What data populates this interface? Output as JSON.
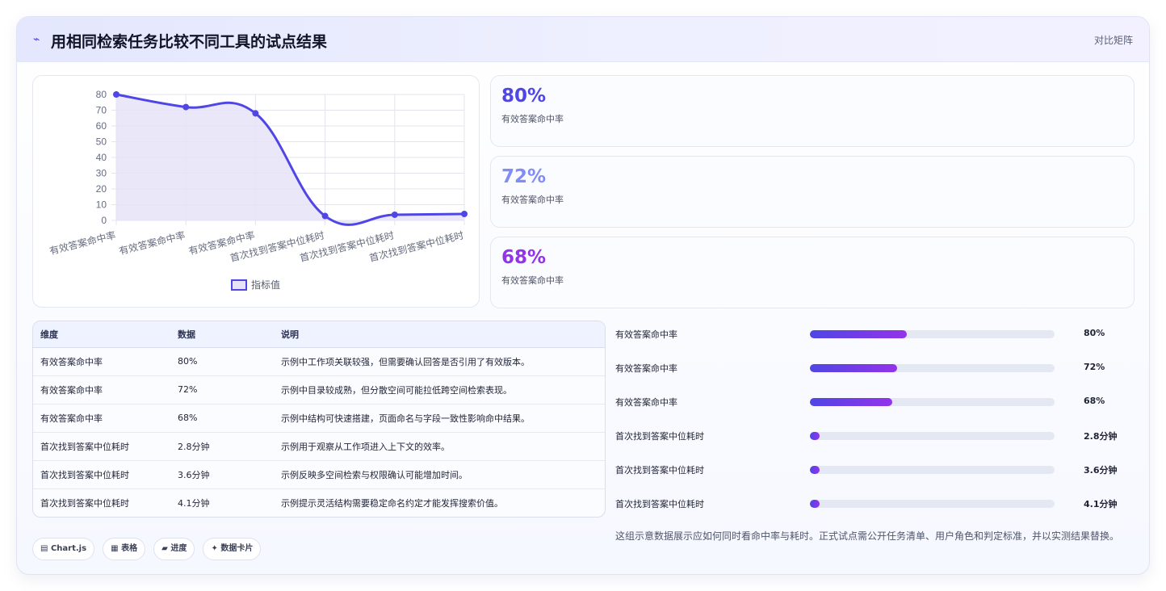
{
  "header": {
    "title_icon": "⌁",
    "title": "用相同检索任务比较不同工具的试点结果",
    "matrix_link": "对比矩阵"
  },
  "chart_data": {
    "type": "line",
    "categories": [
      "有效答案命中率",
      "有效答案命中率",
      "有效答案命中率",
      "首次找到答案中位耗时",
      "首次找到答案中位耗时",
      "首次找到答案中位耗时"
    ],
    "series": [
      {
        "name": "指标值",
        "values": [
          80,
          72,
          68,
          2.8,
          3.6,
          4.1
        ]
      }
    ],
    "ylim": [
      0,
      80
    ],
    "yticks": [
      0,
      10,
      20,
      30,
      40,
      50,
      60,
      70,
      80
    ],
    "grid": true,
    "fill": true,
    "legend_position": "bottom",
    "colors": {
      "line": "#4f46e5",
      "fill": "#e6e3f8"
    }
  },
  "kpis": [
    {
      "value": "80%",
      "label": "有效答案命中率",
      "color": "#4f46e5"
    },
    {
      "value": "72%",
      "label": "有效答案命中率",
      "color": "#818cf8"
    },
    {
      "value": "68%",
      "label": "有效答案命中率",
      "color": "#9333ea"
    }
  ],
  "table": {
    "headers": [
      "维度",
      "数据",
      "说明"
    ],
    "rows": [
      [
        "有效答案命中率",
        "80%",
        "示例中工作项关联较强，但需要确认回答是否引用了有效版本。"
      ],
      [
        "有效答案命中率",
        "72%",
        "示例中目录较成熟，但分散空间可能拉低跨空间检索表现。"
      ],
      [
        "有效答案命中率",
        "68%",
        "示例中结构可快速搭建，页面命名与字段一致性影响命中结果。"
      ],
      [
        "首次找到答案中位耗时",
        "2.8分钟",
        "示例用于观察从工作项进入上下文的效率。"
      ],
      [
        "首次找到答案中位耗时",
        "3.6分钟",
        "示例反映多空间检索与权限确认可能增加时间。"
      ],
      [
        "首次找到答案中位耗时",
        "4.1分钟",
        "示例提示灵活结构需要稳定命名约定才能发挥搜索价值。"
      ]
    ]
  },
  "chips": [
    {
      "icon": "▤",
      "label": "Chart.js"
    },
    {
      "icon": "▦",
      "label": "表格"
    },
    {
      "icon": "▰",
      "label": "进度"
    },
    {
      "icon": "✦",
      "label": "数据卡片"
    }
  ],
  "bars": [
    {
      "label": "有效答案命中率",
      "value": "80%",
      "fill": 0.395
    },
    {
      "label": "有效答案命中率",
      "value": "72%",
      "fill": 0.356
    },
    {
      "label": "有效答案命中率",
      "value": "68%",
      "fill": 0.336
    },
    {
      "label": "首次找到答案中位耗时",
      "value": "2.8分钟",
      "fill": 0.04
    },
    {
      "label": "首次找到答案中位耗时",
      "value": "3.6分钟",
      "fill": 0.04
    },
    {
      "label": "首次找到答案中位耗时",
      "value": "4.1分钟",
      "fill": 0.04
    }
  ],
  "footnote": "这组示意数据展示应如何同时看命中率与耗时。正式试点需公开任务清单、用户角色和判定标准，并以实测结果替换。"
}
